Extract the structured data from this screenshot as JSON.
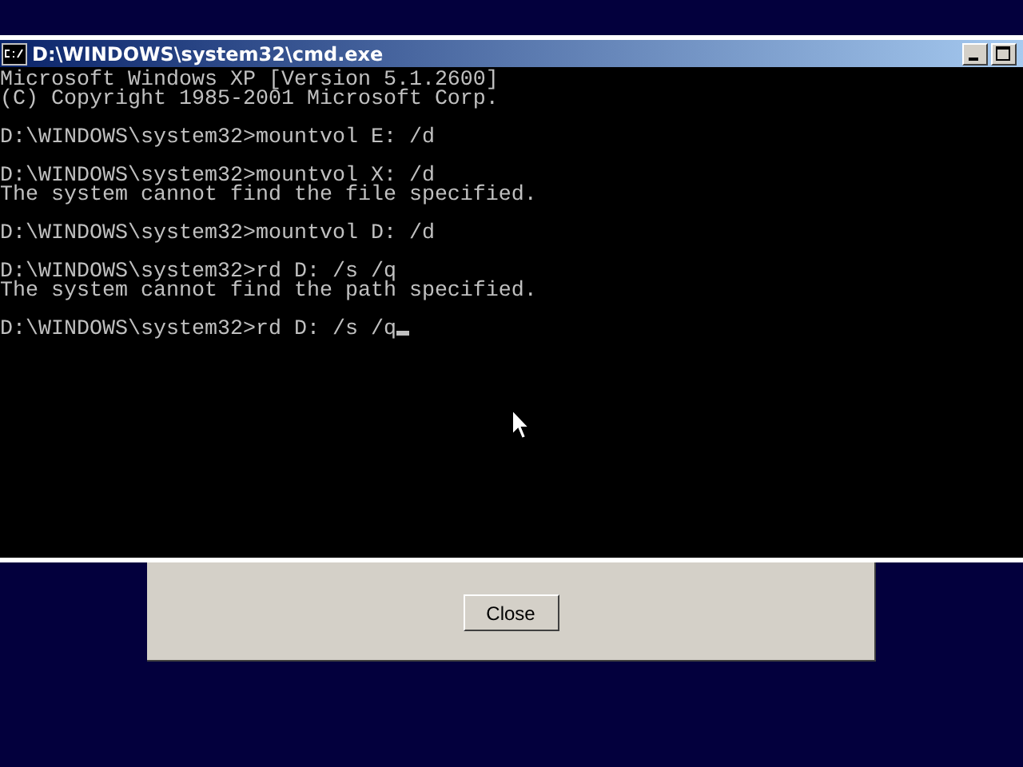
{
  "window": {
    "title": "D:\\WINDOWS\\system32\\cmd.exe"
  },
  "console": {
    "blocks": [
      [
        "Microsoft Windows XP [Version 5.1.2600]",
        "(C) Copyright 1985-2001 Microsoft Corp."
      ],
      [
        "D:\\WINDOWS\\system32>mountvol E: /d"
      ],
      [
        "D:\\WINDOWS\\system32>mountvol X: /d",
        "The system cannot find the file specified."
      ],
      [
        "D:\\WINDOWS\\system32>mountvol D: /d"
      ],
      [
        "D:\\WINDOWS\\system32>rd D: /s /q",
        "The system cannot find the path specified."
      ],
      [
        "D:\\WINDOWS\\system32>rd D: /s /q"
      ]
    ],
    "cursor": true
  },
  "dialog": {
    "buttons": [
      "Close"
    ]
  }
}
